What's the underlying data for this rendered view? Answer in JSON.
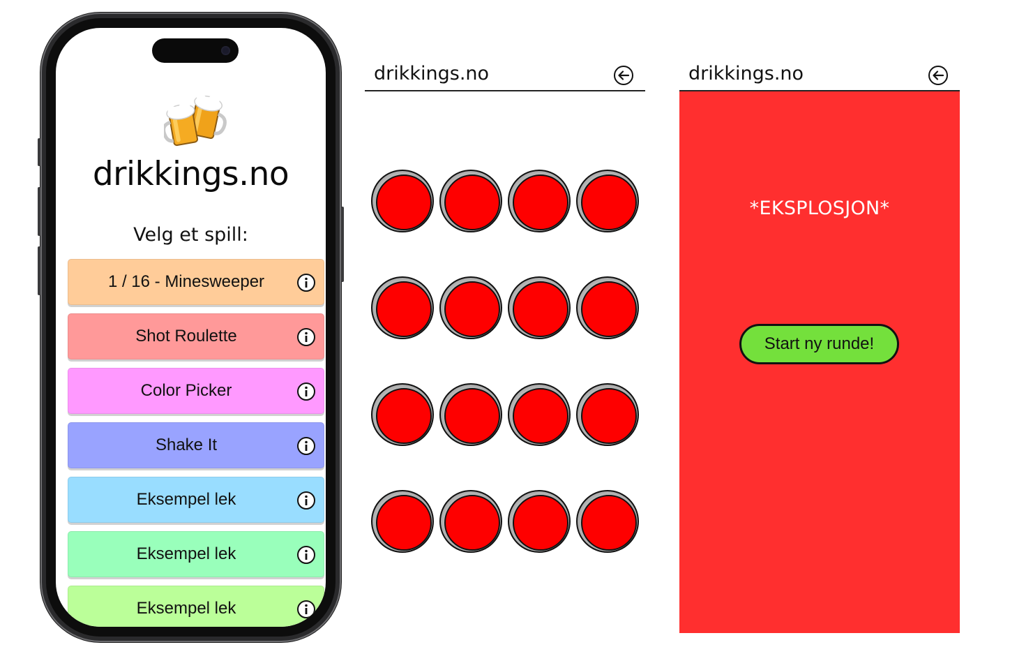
{
  "home": {
    "title": "drikkings.no",
    "subtitle": "Velg et spill:",
    "icon": "beer-mugs-icon",
    "games": [
      {
        "label": "1 / 16 - Minesweeper",
        "color": "#ffcc99"
      },
      {
        "label": "Shot Roulette",
        "color": "#ff9999"
      },
      {
        "label": "Color Picker",
        "color": "#ff99ff"
      },
      {
        "label": "Shake It",
        "color": "#99a3ff"
      },
      {
        "label": "Eksempel lek",
        "color": "#99ddff"
      },
      {
        "label": "Eksempel lek",
        "color": "#99ffbb"
      },
      {
        "label": "Eksempel lek",
        "color": "#bbff99"
      }
    ]
  },
  "minesweeper": {
    "title": "drikkings.no",
    "back_icon": "back-arrow-icon",
    "button_color": "#fe0000",
    "rows": 4,
    "cols": 4
  },
  "explosion": {
    "title": "drikkings.no",
    "back_icon": "back-arrow-icon",
    "background": "#ff2f2f",
    "message": "*EKSPLOSJON*",
    "restart_label": "Start ny runde!",
    "restart_color": "#74e03c"
  }
}
